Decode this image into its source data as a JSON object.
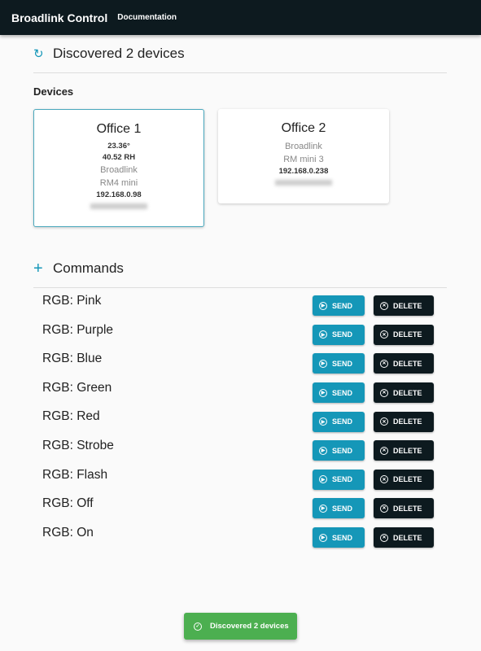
{
  "header": {
    "title": "Broadlink Control",
    "doc_link": "Documentation"
  },
  "discovery": {
    "title": "Discovered 2 devices"
  },
  "devices_label": "Devices",
  "devices": [
    {
      "name": "Office 1",
      "temperature": "23.36°",
      "humidity": "40.52 RH",
      "brand": "Broadlink",
      "model": "RM4 mini",
      "ip": "192.168.0.98"
    },
    {
      "name": "Office 2",
      "brand": "Broadlink",
      "model": "RM mini 3",
      "ip": "192.168.0.238"
    }
  ],
  "commands": {
    "title": "Commands",
    "send_label": "SEND",
    "delete_label": "DELETE",
    "items": [
      "RGB: Pink",
      "RGB: Purple",
      "RGB: Blue",
      "RGB: Green",
      "RGB: Red",
      "RGB: Strobe",
      "RGB: Flash",
      "RGB: Off",
      "RGB: On"
    ]
  },
  "toast": "Discovered 2 devices"
}
